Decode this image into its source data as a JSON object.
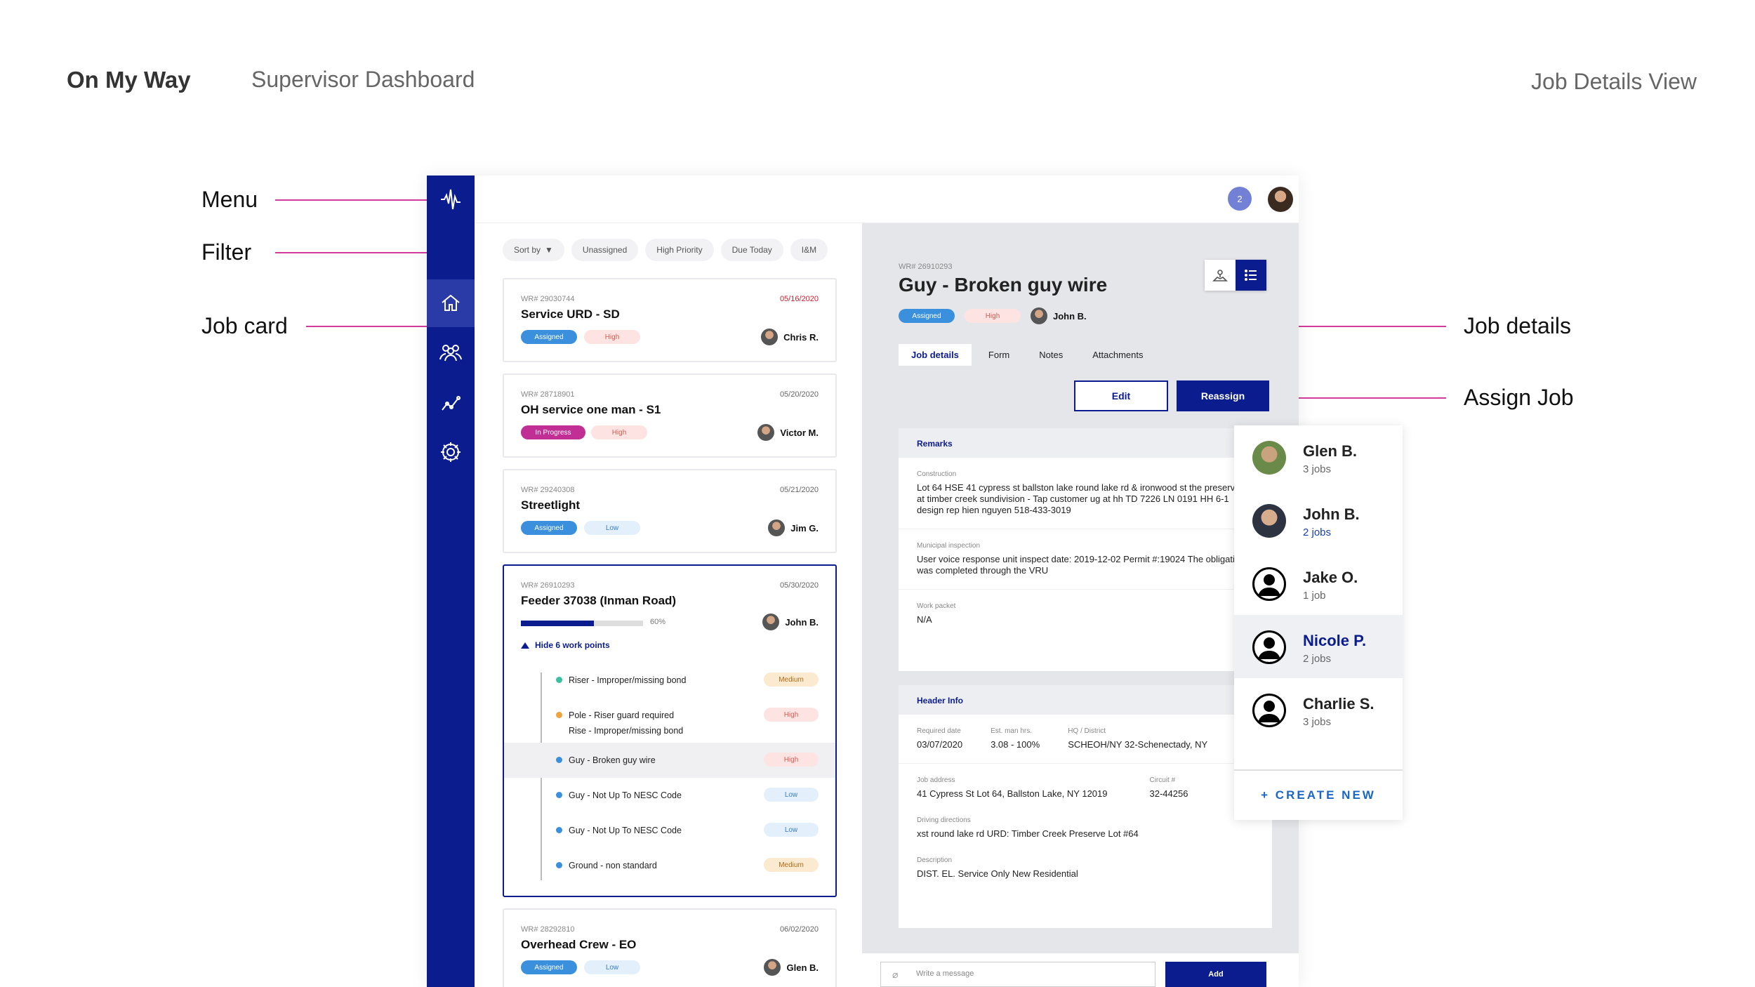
{
  "header": {
    "brand": "On My Way",
    "section": "Supervisor Dashboard",
    "view": "Job Details View"
  },
  "callouts": {
    "menu": "Menu",
    "filter": "Filter",
    "job_card": "Job card",
    "job_details": "Job details",
    "assign_job": "Assign Job"
  },
  "topbar": {
    "notification_count": "2"
  },
  "filters": [
    "Sort by",
    "Unassigned",
    "High Priority",
    "Due Today",
    "I&M"
  ],
  "cards": [
    {
      "wr": "WR# 29030744",
      "date": "05/16/2020",
      "title": "Service URD - SD",
      "status": "Assigned",
      "priority": "High",
      "person": "Chris R."
    },
    {
      "wr": "WR# 28718901",
      "date": "05/20/2020",
      "title": "OH service one man - S1",
      "status": "In Progress",
      "priority": "High",
      "person": "Victor M."
    },
    {
      "wr": "WR# 29240308",
      "date": "05/21/2020",
      "title": "Streetlight",
      "status": "Assigned",
      "priority": "Low",
      "person": "Jim G."
    },
    {
      "wr": "WR# 26910293",
      "date": "05/30/2020",
      "title": "Feeder 37038 (Inman Road)",
      "progress": "60%",
      "person": "John B.",
      "toggle": "Hide 6 work points"
    },
    {
      "wr": "WR# 28292810",
      "date": "06/02/2020",
      "title": "Overhead Crew - EO",
      "status": "Assigned",
      "priority": "Low",
      "person": "Glen B."
    }
  ],
  "work_points": [
    {
      "line1": "Riser - Improper/missing bond",
      "line2": "",
      "priority": "Medium",
      "dot": "#3cbf9f"
    },
    {
      "line1": "Pole - Riser guard required",
      "line2": "Rise - Improper/missing bond",
      "priority": "High",
      "dot": "#f0a23c"
    },
    {
      "line1": "Guy - Broken guy wire",
      "line2": "",
      "priority": "High",
      "dot": "#3a90dd"
    },
    {
      "line1": "Guy - Not Up To NESC Code",
      "line2": "",
      "priority": "Low",
      "dot": "#3a90dd"
    },
    {
      "line1": "Guy - Not Up To NESC Code",
      "line2": "",
      "priority": "Low",
      "dot": "#3a90dd"
    },
    {
      "line1": "Ground - non standard",
      "line2": "",
      "priority": "Medium",
      "dot": "#3a90dd"
    }
  ],
  "detail": {
    "wr": "WR# 26910293",
    "title": "Guy - Broken guy wire",
    "status": "Assigned",
    "priority": "High",
    "person": "John B.",
    "tabs": [
      "Job details",
      "Form",
      "Notes",
      "Attachments"
    ],
    "edit": "Edit",
    "reassign": "Reassign",
    "remarks_title": "Remarks",
    "construction_label": "Construction",
    "construction": "Lot 64 HSE 41 cypress st ballston lake round lake rd & ironwood st the preserve at timber creek sundivision - Tap customer ug at hh TD 7226 LN 0191 HH 6-1 design rep hien nguyen 518-433-3019",
    "municipal_label": "Municipal inspection",
    "municipal": "User voice response unit inspect date: 2019-12-02 Permit #:19024 The obligation was completed through the VRU",
    "packet_label": "Work packet",
    "packet": "N/A",
    "header_title": "Header Info",
    "req_label": "Required date",
    "req": "03/07/2020",
    "est_label": "Est. man hrs.",
    "est": "3.08 - 100%",
    "hq_label": "HQ / District",
    "hq": "SCHEOH/NY 32-Schenectady, NY",
    "addr_label": "Job address",
    "addr": "41 Cypress St Lot 64, Ballston Lake, NY 12019",
    "circuit_label": "Circuit #",
    "circuit": "32-44256",
    "dir_label": "Driving directions",
    "dir": "xst round lake rd URD: Timber Creek Preserve Lot #64",
    "desc_label": "Description",
    "desc": "DIST. EL. Service Only New Residential",
    "message_placeholder": "Write a message",
    "add": "Add"
  },
  "assignees": [
    {
      "name": "Glen B.",
      "jobs": "3 jobs"
    },
    {
      "name": "John B.",
      "jobs": "2 jobs"
    },
    {
      "name": "Jake O.",
      "jobs": "1 job"
    },
    {
      "name": "Nicole P.",
      "jobs": "2 jobs"
    },
    {
      "name": "Charlie S.",
      "jobs": "3 jobs"
    }
  ],
  "create_new": "+ CREATE NEW",
  "colors": {
    "brand": "#0b1d8e",
    "callout_line": "#d23b9b",
    "assigned": "#3a90dd",
    "in_progress": "#c12e94"
  }
}
